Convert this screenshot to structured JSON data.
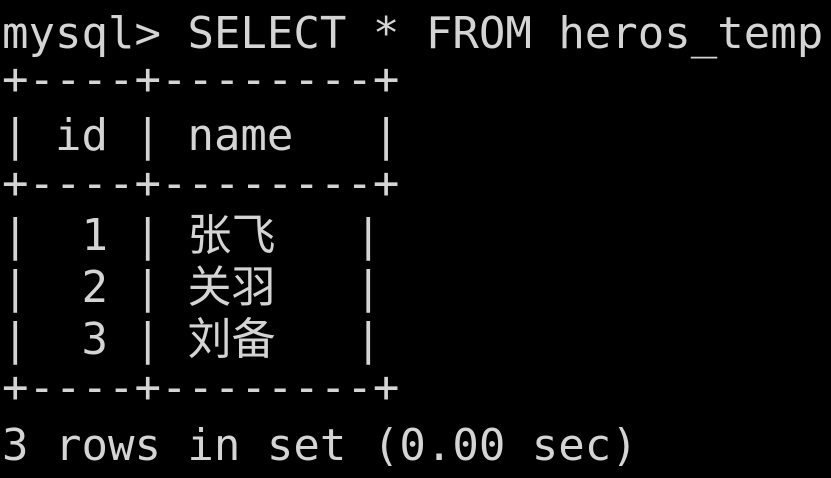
{
  "terminal": {
    "prompt": "mysql>",
    "command": "SELECT * FROM heros_temp;",
    "border": "+----+--------+",
    "columns": [
      "id",
      "name"
    ],
    "rows": [
      {
        "id": "1",
        "name": "张飞"
      },
      {
        "id": "2",
        "name": "关羽"
      },
      {
        "id": "3",
        "name": "刘备"
      }
    ],
    "status": "3 rows in set (0.00 sec)"
  }
}
